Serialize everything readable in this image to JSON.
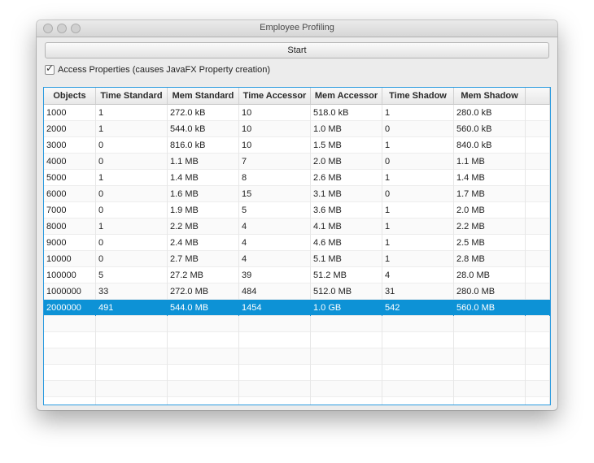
{
  "window": {
    "title": "Employee Profiling",
    "traffic_lights": [
      "close",
      "minimize",
      "zoom"
    ]
  },
  "toolbar": {
    "start_label": "Start"
  },
  "options": {
    "access_properties_label": "Access Properties (causes JavaFX Property creation)",
    "access_properties_checked": true
  },
  "table": {
    "columns": [
      "Objects",
      "Time Standard",
      "Mem Standard",
      "Time Accessor",
      "Mem Accessor",
      "Time Shadow",
      "Mem Shadow"
    ],
    "rows": [
      [
        "1000",
        "1",
        "272.0 kB",
        "10",
        "518.0 kB",
        "1",
        "280.0 kB"
      ],
      [
        "2000",
        "1",
        "544.0 kB",
        "10",
        "1.0 MB",
        "0",
        "560.0 kB"
      ],
      [
        "3000",
        "0",
        "816.0 kB",
        "10",
        "1.5 MB",
        "1",
        "840.0 kB"
      ],
      [
        "4000",
        "0",
        "1.1 MB",
        "7",
        "2.0 MB",
        "0",
        "1.1 MB"
      ],
      [
        "5000",
        "1",
        "1.4 MB",
        "8",
        "2.6 MB",
        "1",
        "1.4 MB"
      ],
      [
        "6000",
        "0",
        "1.6 MB",
        "15",
        "3.1 MB",
        "0",
        "1.7 MB"
      ],
      [
        "7000",
        "0",
        "1.9 MB",
        "5",
        "3.6 MB",
        "1",
        "2.0 MB"
      ],
      [
        "8000",
        "1",
        "2.2 MB",
        "4",
        "4.1 MB",
        "1",
        "2.2 MB"
      ],
      [
        "9000",
        "0",
        "2.4 MB",
        "4",
        "4.6 MB",
        "1",
        "2.5 MB"
      ],
      [
        "10000",
        "0",
        "2.7 MB",
        "4",
        "5.1 MB",
        "1",
        "2.8 MB"
      ],
      [
        "100000",
        "5",
        "27.2 MB",
        "39",
        "51.2 MB",
        "4",
        "28.0 MB"
      ],
      [
        "1000000",
        "33",
        "272.0 MB",
        "484",
        "512.0 MB",
        "31",
        "280.0 MB"
      ],
      [
        "2000000",
        "491",
        "544.0 MB",
        "1454",
        "1.0 GB",
        "542",
        "560.0 MB"
      ]
    ],
    "selected_row_index": 12,
    "empty_rows": 6
  },
  "colors": {
    "selection": "#0d92d6",
    "focus_border": "#2b9be0"
  }
}
